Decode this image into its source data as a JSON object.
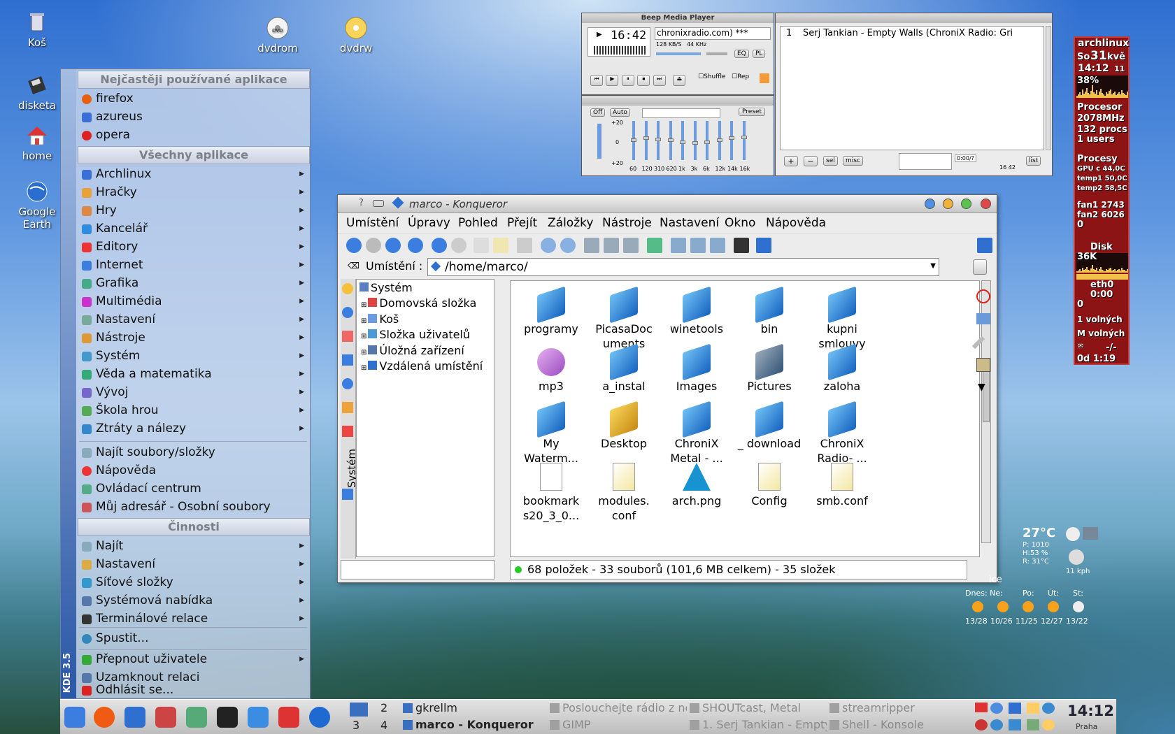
{
  "desktop": {
    "icons": [
      {
        "label": "Koš"
      },
      {
        "label": "dvdrom"
      },
      {
        "label": "dvdrw"
      },
      {
        "label": "disketa"
      },
      {
        "label": "home"
      },
      {
        "label": "Google Earth"
      }
    ]
  },
  "kmenu": {
    "brand": "KDE 3.5",
    "section_frequent": "Nejčastěji používané aplikace",
    "frequent": [
      "firefox",
      "azureus",
      "opera"
    ],
    "section_all": "Všechny aplikace",
    "apps": [
      "Archlinux",
      "Hračky",
      "Hry",
      "Kancelář",
      "Editory",
      "Internet",
      "Grafika",
      "Multimédia",
      "Nastavení",
      "Nástroje",
      "Systém",
      "Věda a matematika",
      "Vývoj",
      "Škola hrou",
      "Ztráty a nálezy"
    ],
    "extra": [
      "Najít soubory/složky",
      "Nápověda",
      "Ovládací centrum",
      "Můj adresář - Osobní soubory"
    ],
    "section_actions": "Činnosti",
    "actions": [
      "Najít",
      "Nastavení",
      "Síťové složky",
      "Systémová nabídka",
      "Terminálové relace"
    ],
    "run": "Spustit...",
    "bottom": [
      "Přepnout uživatele",
      "Uzamknout relaci",
      "Odhlásit se..."
    ]
  },
  "bmp": {
    "title": "Beep Media Player",
    "time": "16:42",
    "station": "chronixradio.com)",
    "stars": "***",
    "bitrate": "128 KB/S",
    "freq": "44 KHz",
    "eq_btn": "EQ",
    "pl_btn": "PL",
    "shuffle": "Shuffle",
    "repeat": "Rep",
    "eq_off": "Off",
    "eq_auto": "Auto",
    "eq_preset": "Preset",
    "eq_plus": "+20",
    "eq_zero": "0",
    "eq_minus": "+20",
    "eq_bands": [
      "60",
      "120",
      "310",
      "620",
      "1k",
      "3k",
      "6k",
      "12k",
      "14k",
      "16k"
    ],
    "eq_levels": [
      0.55,
      0.6,
      0.58,
      0.55,
      0.5,
      0.48,
      0.5,
      0.55,
      0.6,
      0.62
    ],
    "playlist_num": "1",
    "playlist_title": "Serj Tankian - Empty Walls (ChroniX Radio: Gri",
    "pl_add": "+",
    "pl_rem": "−",
    "pl_sel": "sel",
    "pl_misc": "misc",
    "pl_list": "list",
    "pl_time": "0:00/?",
    "pl_total": "16 42"
  },
  "konq": {
    "title": "marco - Konqueror",
    "menu": [
      "Umístění",
      "Úpravy",
      "Pohled",
      "Přejít",
      "Záložky",
      "Nástroje",
      "Nastavení",
      "Okno",
      "Nápověda"
    ],
    "location_label": "Umístění :",
    "location": "/home/marco/",
    "tree": [
      "Systém",
      "Domovská složka",
      "Koš",
      "Složka uživatelů",
      "Úložná zařízení",
      "Vzdálená umístění"
    ],
    "sidebar_label": "Systém",
    "files": [
      {
        "name": "programy",
        "icon": "folder-warning-icon"
      },
      {
        "name": "PicasaDoc uments",
        "icon": "folder-icon"
      },
      {
        "name": "winetools",
        "icon": "folder-icon"
      },
      {
        "name": "bin",
        "icon": "folder-icon"
      },
      {
        "name": "kupni smlouvy",
        "icon": "folder-icon"
      },
      {
        "name": "mp3",
        "icon": "music-folder-icon"
      },
      {
        "name": "a_instal",
        "icon": "folder-icon"
      },
      {
        "name": "Images",
        "icon": "folder-icon"
      },
      {
        "name": "Pictures",
        "icon": "pictures-folder-icon"
      },
      {
        "name": "zaloha",
        "icon": "folder-icon"
      },
      {
        "name": "My Waterm...",
        "icon": "folder-icon"
      },
      {
        "name": "Desktop",
        "icon": "desktop-folder-icon"
      },
      {
        "name": "ChroniX Metal - ...",
        "icon": "folder-icon"
      },
      {
        "name": "_ download",
        "icon": "folder-icon"
      },
      {
        "name": "ChroniX Radio- ...",
        "icon": "folder-icon"
      },
      {
        "name": "bookmark s20_3_0...",
        "icon": "text-file-icon"
      },
      {
        "name": "modules. conf",
        "icon": "config-file-icon"
      },
      {
        "name": "arch.png",
        "icon": "arch-image-icon"
      },
      {
        "name": "Config",
        "icon": "config-file-icon"
      },
      {
        "name": "smb.conf",
        "icon": "config-file-icon"
      }
    ],
    "status": "68 položek - 33 souborů (101,6 MB celkem) - 35 složek"
  },
  "gkrellm": {
    "host": "archlinux",
    "date_day": "So",
    "date_num": "31",
    "date_month": "kvě",
    "time": "14:12",
    "time_sec": "11",
    "cpu_pct": "38%",
    "cpu_label": "Procesor",
    "cpu_freq": "2078MHz",
    "procs": "132 procs",
    "users": "1 users",
    "proc_label": "Procesy",
    "gpu": "GPU c 44,0C",
    "temp1": "temp1 50,0C",
    "temp2": "temp2 58,5C",
    "fan1": "fan1 2743",
    "fan2": "fan2 6026",
    "zero1": "0",
    "disk_label": "Disk",
    "disk_val": "36K",
    "eth_label": "eth0",
    "eth_time": "0:00",
    "zero2": "0",
    "mem1": "1 volných",
    "mem2": "M volných",
    "mail": "-/-",
    "uptime": "0d 1:19"
  },
  "weather": {
    "temp": "27°C",
    "pressure": "P: 1010",
    "humidity": "H:53 %",
    "real": "R: 31°C",
    "wind": "11 kph",
    "city_frag": "ice",
    "days": [
      "Dnes: Ne:",
      "Po:",
      "Út:",
      "St:"
    ],
    "temps": [
      "13/28",
      "10/26",
      "11/25",
      "12/27",
      "13/22"
    ]
  },
  "taskbar": {
    "desk_nums": [
      "2",
      "3",
      "4"
    ],
    "tasks": [
      {
        "label": "gkrellm",
        "dim": false
      },
      {
        "label": "marco - Konqueror",
        "dim": false
      },
      {
        "label": "Poslouchejte rádio z ne",
        "dim": true
      },
      {
        "label": "GIMP",
        "dim": true
      },
      {
        "label": "SHOUTcast, Metal",
        "dim": true
      },
      {
        "label": "1. Serj Tankian - Empty",
        "dim": true
      },
      {
        "label": "streamripper",
        "dim": true
      },
      {
        "label": "Shell - Konsole",
        "dim": true
      }
    ],
    "clock": "14:12",
    "city": "Praha"
  },
  "colors": {
    "accent": "#2f6fd0",
    "gk_bg": "#8c1414",
    "folder": "#2f8de0"
  }
}
